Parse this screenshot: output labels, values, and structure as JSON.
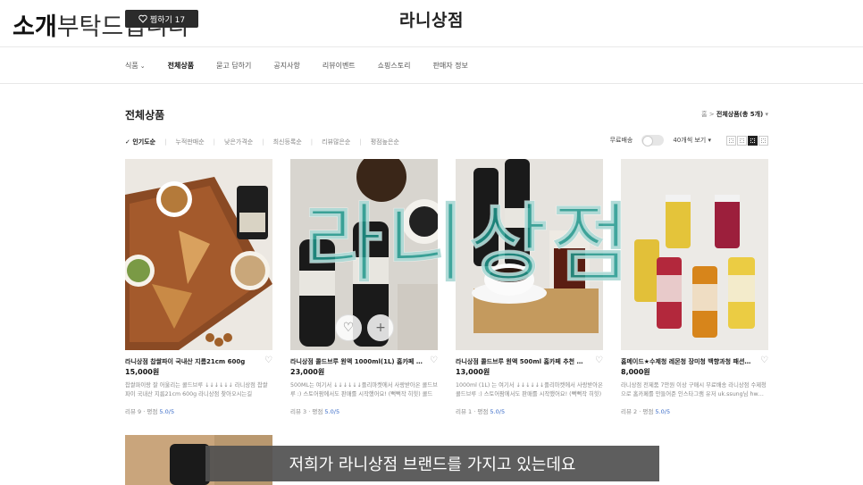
{
  "header": {
    "store_title": "라니상점",
    "caption_bold": "소개",
    "caption_light": "부탁드립니다",
    "like_label": "찜하기 17"
  },
  "nav": {
    "items": [
      {
        "label": "식품",
        "caret": "⌄"
      },
      {
        "label": "전체상품"
      },
      {
        "label": "묻고 답하기"
      },
      {
        "label": "공지사항"
      },
      {
        "label": "리뷰이벤트"
      },
      {
        "label": "쇼핑스토리"
      },
      {
        "label": "판매자 정보"
      }
    ]
  },
  "section": {
    "title": "전체상품",
    "breadcrumb_home": "홈",
    "breadcrumb_sep": ">",
    "breadcrumb_current": "전체상품(총 5개)",
    "breadcrumb_caret": "▾"
  },
  "sort": {
    "items": [
      "인기도순",
      "누적판매순",
      "낮은가격순",
      "최신등록순",
      "리뷰많은순",
      "평점높은순"
    ],
    "check": "✓",
    "separator": "|"
  },
  "controls": {
    "free_shipping": "무료배송",
    "per_page": "40개씩 보기",
    "per_page_caret": "▾"
  },
  "products": [
    {
      "name": "라니상점 찹쌀파이 국내산 지름21cm 600g",
      "price": "15,000원",
      "desc": "찹쌀파이랑 잘 어울리는 콜드브루 ↓↓↓↓↓↓ 라니상점 찹쌀파이 국내산 지름21cm 600g 라니상점 찾아오시는길",
      "review_label": "리뷰 9",
      "rating_label": "평점",
      "rating": "5.0/5"
    },
    {
      "name": "라니상점 콜드브루 원액 1000ml(1L) 홈카페 추…",
      "price": "23,000원",
      "desc": "500ML는 여기서 ↓↓↓↓↓↓플리마켓에서 사랑받아온 콜드브루 :) 스토어팜에서도 판매를 시작했어요! (뻑뻑작 히힛) 콜드브…",
      "review_label": "리뷰 3",
      "rating_label": "평점",
      "rating": "5.0/5"
    },
    {
      "name": "라니상점 콜드브루 원액 500ml 홈카페 추천 더치…",
      "price": "13,000원",
      "desc": "1000ml (1L) 는 여기서 ↓↓↓↓↓↓플리마켓에서 사랑받아온 콜드브루 :) 스토어팜에서도 판매를 시작했어요! (뻑뻑작 히힛) …",
      "review_label": "리뷰 1",
      "rating_label": "평점",
      "rating": "5.0/5"
    },
    {
      "name": "홈메이드★수제청 레몬청 장미청 백향과청 패션후…",
      "price": "8,000원",
      "desc": "라니상점 전제품 7만원 이상 구매시 무료배송 라니상점 수제청으로 홈카페를 만들어준 인스타그램 유저 uk.ssung님 hw…",
      "review_label": "리뷰 2",
      "rating_label": "평점",
      "rating": "5.0/5"
    }
  ],
  "watermark": "라니상점",
  "subtitle": "저희가 라니상점 브랜드를 가지고 있는데요",
  "icons": {
    "heart": "♡",
    "plus": "+"
  }
}
